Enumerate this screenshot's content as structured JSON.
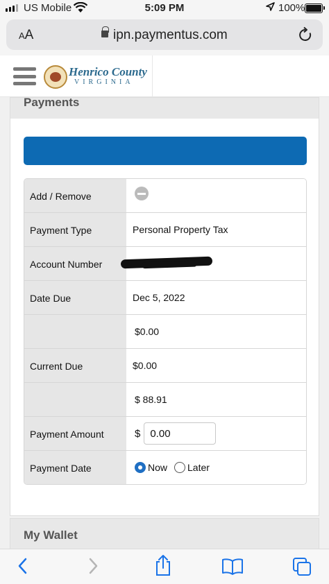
{
  "status_bar": {
    "carrier": "US  Mobile",
    "time": "5:09 PM",
    "battery": "100%"
  },
  "browser": {
    "text_size_label": "AA",
    "url": "ipn.paymentus.com"
  },
  "site": {
    "logo_name": "Henrico County",
    "logo_state": "VIRGINIA"
  },
  "payments": {
    "section_title": "Payments",
    "rows": {
      "add_remove": {
        "label": "Add / Remove"
      },
      "payment_type": {
        "label": "Payment Type",
        "value": "Personal Property Tax"
      },
      "account_number": {
        "label": "Account Number"
      },
      "date_due": {
        "label": "Date Due",
        "value": "Dec 5, 2022"
      },
      "amount_1": {
        "value": "$0.00"
      },
      "current_due": {
        "label": "Current Due",
        "value": "$0.00"
      },
      "amount_2": {
        "value": "$ 88.91"
      },
      "payment_amount": {
        "label": "Payment Amount",
        "currency": "$",
        "input_value": "0.00"
      },
      "payment_date": {
        "label": "Payment Date",
        "option_now": "Now",
        "option_later": "Later",
        "selected": "Now"
      }
    }
  },
  "wallet": {
    "section_title": "My Wallet"
  },
  "colors": {
    "accent_blue": "#0d6ab3",
    "label_bg": "#e6e6e6",
    "logo_blue": "#2c6a8e"
  },
  "icons": {
    "signal": "cellular-signal-icon",
    "wifi": "wifi-icon",
    "location": "location-arrow-icon",
    "battery": "battery-icon",
    "lock": "lock-icon",
    "reload": "reload-icon",
    "menu": "hamburger-menu-icon",
    "remove": "minus-circle-icon",
    "back": "chevron-left-icon",
    "forward": "chevron-right-icon",
    "share": "share-icon",
    "bookmarks": "book-icon",
    "tabs": "tabs-icon"
  }
}
